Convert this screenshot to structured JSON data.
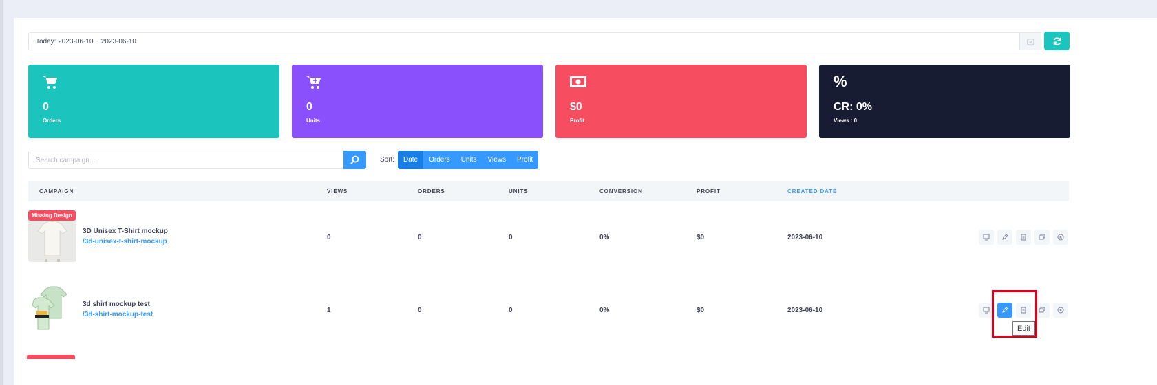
{
  "date_filter": {
    "value": "Today: 2023-06-10 ~ 2023-06-10"
  },
  "stats": [
    {
      "icon": "cart-icon",
      "value": "0",
      "label": "Orders",
      "color": "#1bc5bd"
    },
    {
      "icon": "cart-plus-icon",
      "value": "0",
      "label": "Units",
      "color": "#8950fc"
    },
    {
      "icon": "money-icon",
      "value": "$0",
      "label": "Profit",
      "color": "#f64e60"
    },
    {
      "icon": "percent-icon",
      "value": "CR: 0%",
      "label": "Views : 0",
      "color": "#181c32"
    }
  ],
  "search": {
    "placeholder": "Search campaign..."
  },
  "sort": {
    "label": "Sort:",
    "options": [
      "Date",
      "Orders",
      "Units",
      "Views",
      "Profit"
    ],
    "active": "Date"
  },
  "table": {
    "headers": [
      "CAMPAIGN",
      "VIEWS",
      "ORDERS",
      "UNITS",
      "CONVERSION",
      "PROFIT",
      "CREATED DATE"
    ],
    "sorted_column": "CREATED DATE",
    "rows": [
      {
        "badge": "Missing Design",
        "name": "3D Unisex T-Shirt mockup",
        "slug": "/3d-unisex-t-shirt-mockup",
        "views": "0",
        "orders": "0",
        "units": "0",
        "conversion": "0%",
        "profit": "$0",
        "created": "2023-06-10"
      },
      {
        "badge": "",
        "name": "3d shirt mockup test",
        "slug": "/3d-shirt-mockup-test",
        "views": "1",
        "orders": "0",
        "units": "0",
        "conversion": "0%",
        "profit": "$0",
        "created": "2023-06-10"
      }
    ]
  },
  "row_actions": [
    "preview-icon",
    "edit-icon",
    "copy-icon",
    "clone-icon",
    "delete-icon"
  ],
  "tooltip": {
    "text": "Edit"
  },
  "colors": {
    "accent": "#3699ff",
    "teal": "#1bc5bd",
    "purple": "#8950fc",
    "red": "#f64e60",
    "dark": "#181c32",
    "highlight": "#e0001b"
  }
}
